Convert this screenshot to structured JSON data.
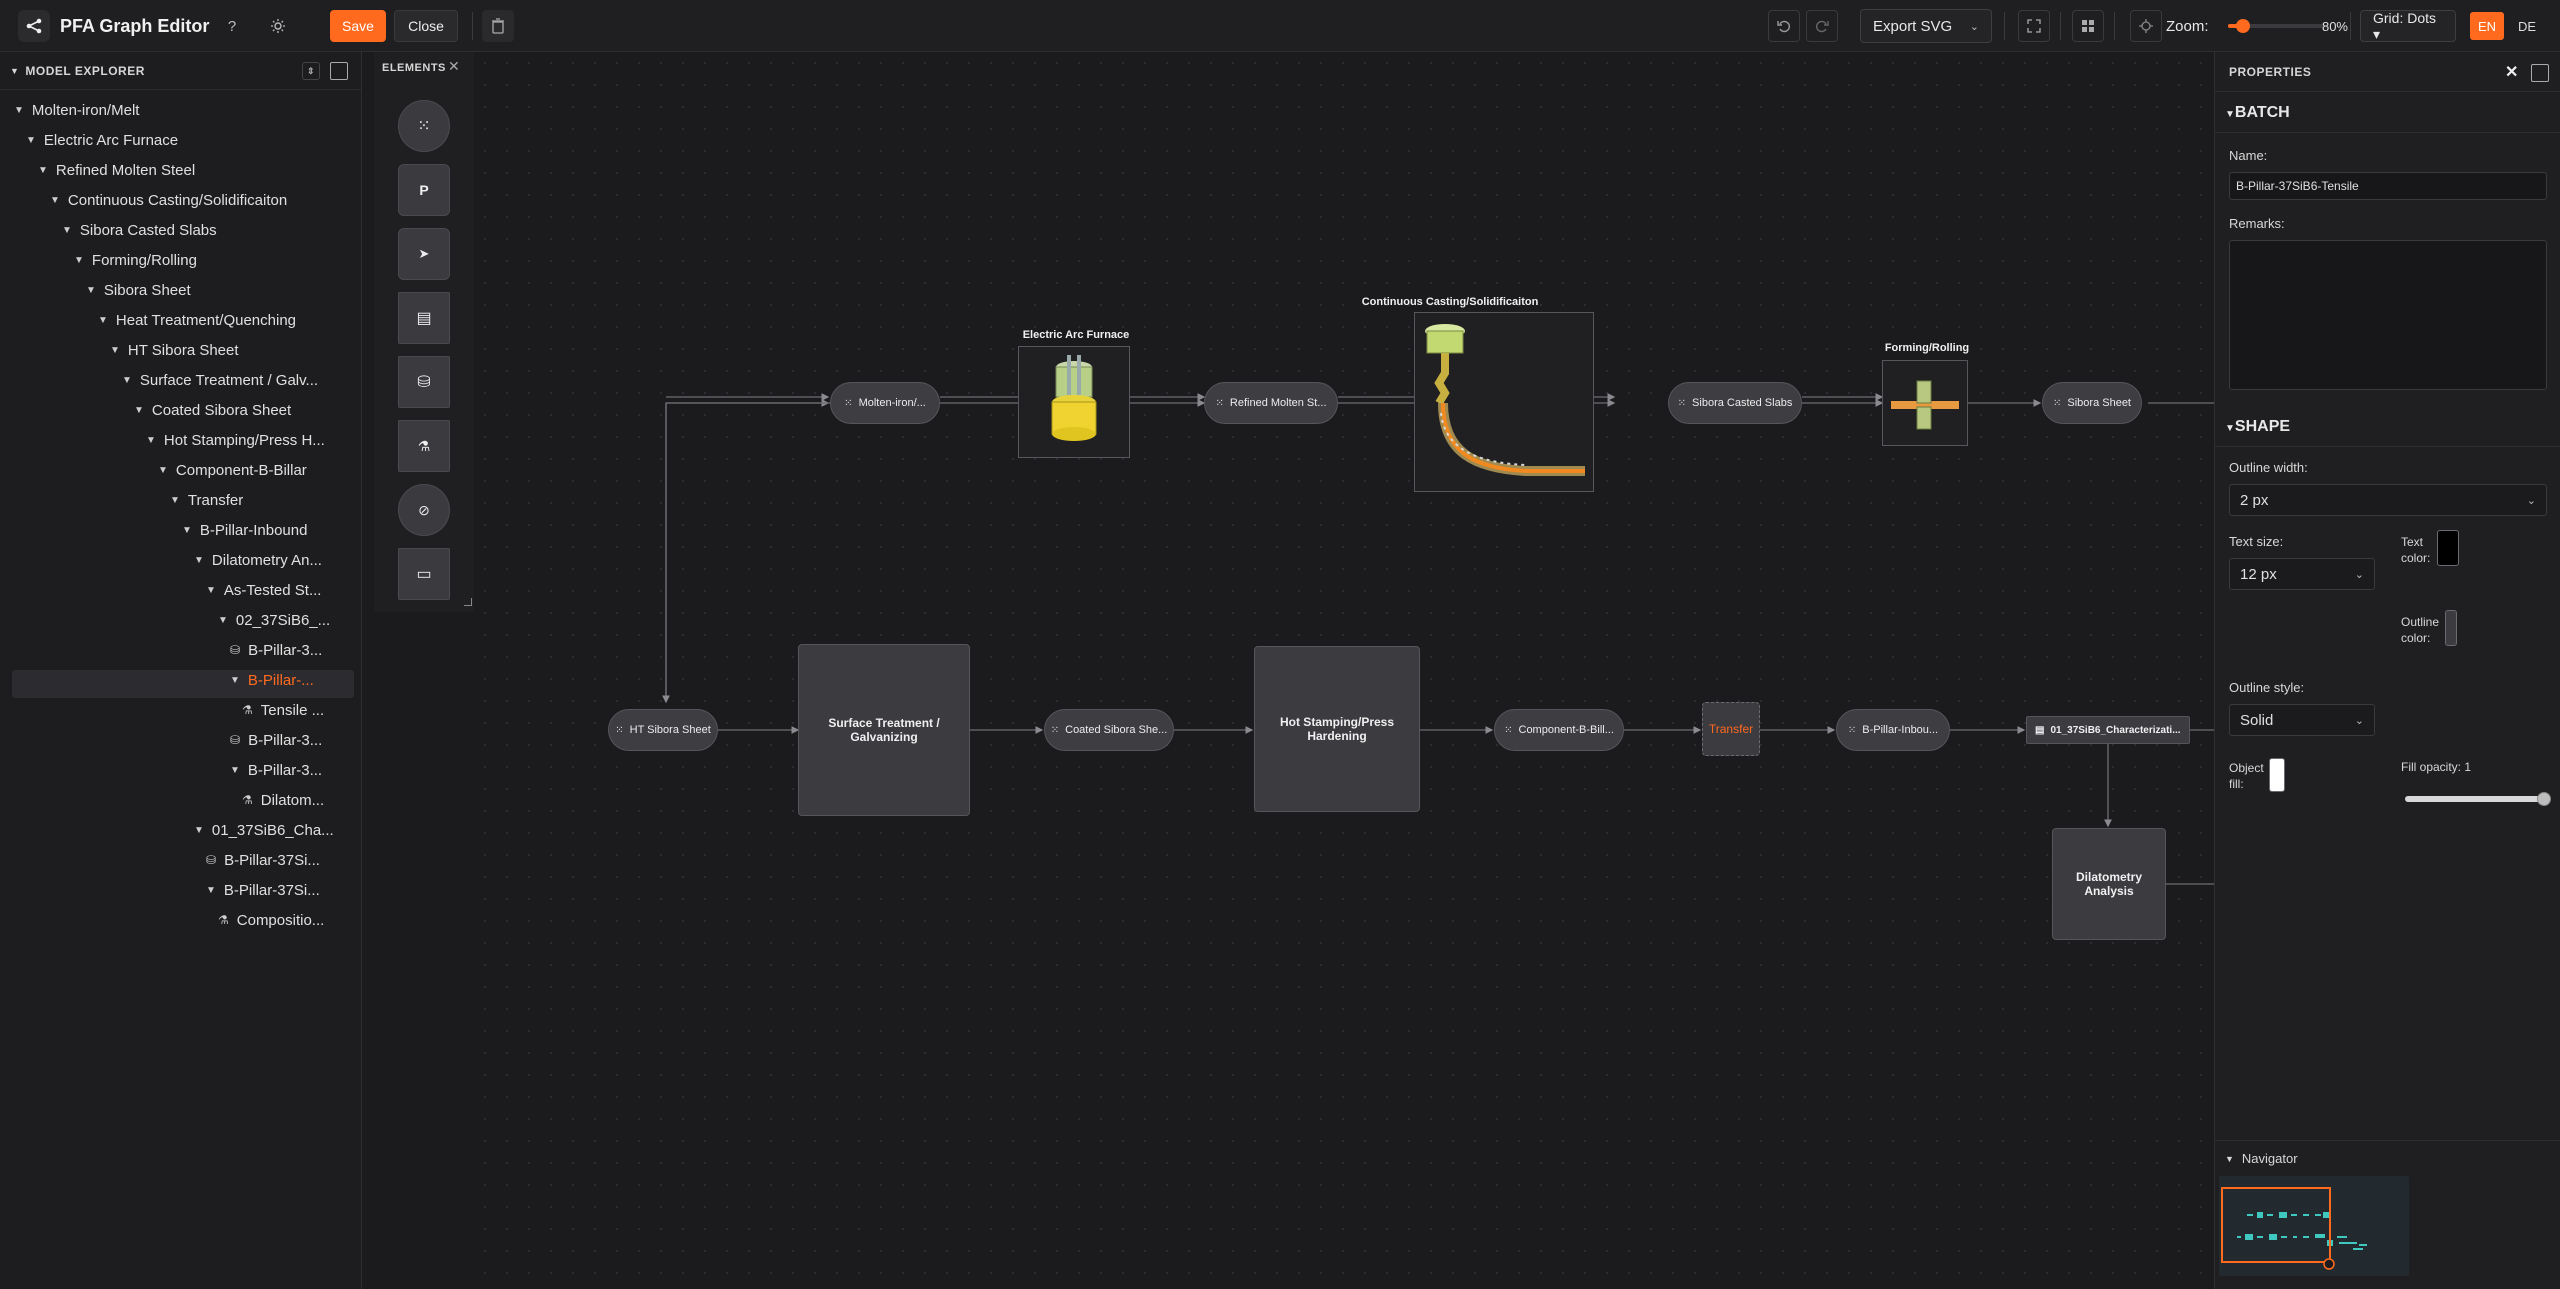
{
  "app": {
    "title": "PFA Graph Editor"
  },
  "toolbar": {
    "help_label": "?",
    "save_label": "Save",
    "close_label": "Close",
    "export_label": "Export SVG",
    "zoom_label": "Zoom:",
    "zoom_value": "80%",
    "zoom_fraction": 0.8,
    "grid_label": "Grid: Dots ▾",
    "lang_en": "EN",
    "lang_de": "DE"
  },
  "explorer": {
    "title": "MODEL EXPLORER",
    "items": [
      {
        "label": "Molten-iron/Melt",
        "depth": 0,
        "type": "branch"
      },
      {
        "label": "Electric Arc Furnace",
        "depth": 1,
        "type": "branch"
      },
      {
        "label": "Refined Molten Steel",
        "depth": 2,
        "type": "branch"
      },
      {
        "label": "Continuous Casting/Solidificaiton",
        "depth": 3,
        "type": "branch"
      },
      {
        "label": "Sibora Casted Slabs",
        "depth": 4,
        "type": "branch"
      },
      {
        "label": "Forming/Rolling",
        "depth": 5,
        "type": "branch"
      },
      {
        "label": "Sibora Sheet",
        "depth": 6,
        "type": "branch"
      },
      {
        "label": "Heat Treatment/Quenching",
        "depth": 7,
        "type": "branch"
      },
      {
        "label": "HT Sibora Sheet",
        "depth": 8,
        "type": "branch"
      },
      {
        "label": "Surface Treatment / Galv...",
        "depth": 9,
        "type": "branch"
      },
      {
        "label": "Coated Sibora Sheet",
        "depth": 10,
        "type": "branch"
      },
      {
        "label": "Hot Stamping/Press H...",
        "depth": 11,
        "type": "branch"
      },
      {
        "label": "Component-B-Billar",
        "depth": 12,
        "type": "branch"
      },
      {
        "label": "Transfer",
        "depth": 13,
        "type": "branch"
      },
      {
        "label": "B-Pillar-Inbound",
        "depth": 14,
        "type": "branch"
      },
      {
        "label": "Dilatometry An...",
        "depth": 15,
        "type": "branch"
      },
      {
        "label": "As-Tested St...",
        "depth": 16,
        "type": "branch"
      },
      {
        "label": "02_37SiB6_...",
        "depth": 17,
        "type": "branch"
      },
      {
        "label": "B-Pillar-3...",
        "depth": 18,
        "type": "db"
      },
      {
        "label": "B-Pillar-...",
        "depth": 18,
        "type": "branch",
        "selected": true
      },
      {
        "label": "Tensile ...",
        "depth": 19,
        "type": "leaf"
      },
      {
        "label": "B-Pillar-3...",
        "depth": 18,
        "type": "db"
      },
      {
        "label": "B-Pillar-3...",
        "depth": 18,
        "type": "branch"
      },
      {
        "label": "Dilatom...",
        "depth": 19,
        "type": "leaf"
      },
      {
        "label": "01_37SiB6_Cha...",
        "depth": 15,
        "type": "branch"
      },
      {
        "label": "B-Pillar-37Si...",
        "depth": 16,
        "type": "db"
      },
      {
        "label": "B-Pillar-37Si...",
        "depth": 16,
        "type": "branch"
      },
      {
        "label": "Compositio...",
        "depth": 17,
        "type": "leaf"
      }
    ]
  },
  "palette": {
    "title": "ELEMENTS",
    "items": [
      {
        "name": "product-node",
        "glyph": "⁙"
      },
      {
        "name": "process-node",
        "glyph": "P"
      },
      {
        "name": "transfer-node",
        "glyph": "➤"
      },
      {
        "name": "document-node",
        "glyph": "▤"
      },
      {
        "name": "database-node",
        "glyph": "⛁"
      },
      {
        "name": "measurement-node",
        "glyph": "⚗"
      },
      {
        "name": "link-node",
        "glyph": "🔗"
      },
      {
        "name": "comment-node",
        "glyph": "▭"
      }
    ]
  },
  "canvas": {
    "ovals": [
      {
        "id": "molten",
        "label": "Molten-iron/..."
      },
      {
        "id": "refined",
        "label": "Refined Molten St..."
      },
      {
        "id": "casted",
        "label": "Sibora Casted Slabs"
      },
      {
        "id": "sheet",
        "label": "Sibora Sheet"
      },
      {
        "id": "ht",
        "label": "HT Sibora Sheet"
      },
      {
        "id": "coated",
        "label": "Coated Sibora She..."
      },
      {
        "id": "component",
        "label": "Component-B-Bill..."
      },
      {
        "id": "inbound",
        "label": "B-Pillar-Inbou..."
      }
    ],
    "processes": [
      {
        "id": "surface",
        "label": "Surface Treatment / Galvanizing"
      },
      {
        "id": "hot",
        "label": "Hot Stamping/Press Hardening"
      },
      {
        "id": "dilato",
        "label": "Dilatometry Analysis"
      }
    ],
    "image_titles": {
      "eaf": "Electric Arc Furnace",
      "ccs": "Continuous Casting/Solidificaiton",
      "roll": "Forming/Rolling"
    },
    "transfer_label": "Transfer",
    "doc_label": "01_37SiB6_Characterizati..."
  },
  "properties": {
    "title": "PROPERTIES",
    "batch_section": "BATCH",
    "name_label": "Name:",
    "name_value": "B-Pillar-37SiB6-Tensile",
    "remarks_label": "Remarks:",
    "remarks_value": "",
    "shape_section": "SHAPE",
    "outline_width_label": "Outline width:",
    "outline_width_value": "2 px",
    "text_size_label": "Text size:",
    "text_size_value": "12 px",
    "text_color_label_1": "Text",
    "text_color_label_2": "color:",
    "text_color": "#000000",
    "outline_color_label_1": "Outline",
    "outline_color_label_2": "color:",
    "outline_color": "#3b3b40",
    "outline_style_label": "Outline style:",
    "outline_style_value": "Solid",
    "object_fill_label_1": "Object",
    "object_fill_label_2": "fill:",
    "object_fill_color": "#ffffff",
    "fill_opacity_label": "Fill opacity: 1",
    "fill_opacity": 1,
    "navigator_label": "Navigator"
  },
  "colors": {
    "accent": "#ff6a1f",
    "background": "#1b1b1d",
    "node": "#3d3d42"
  }
}
